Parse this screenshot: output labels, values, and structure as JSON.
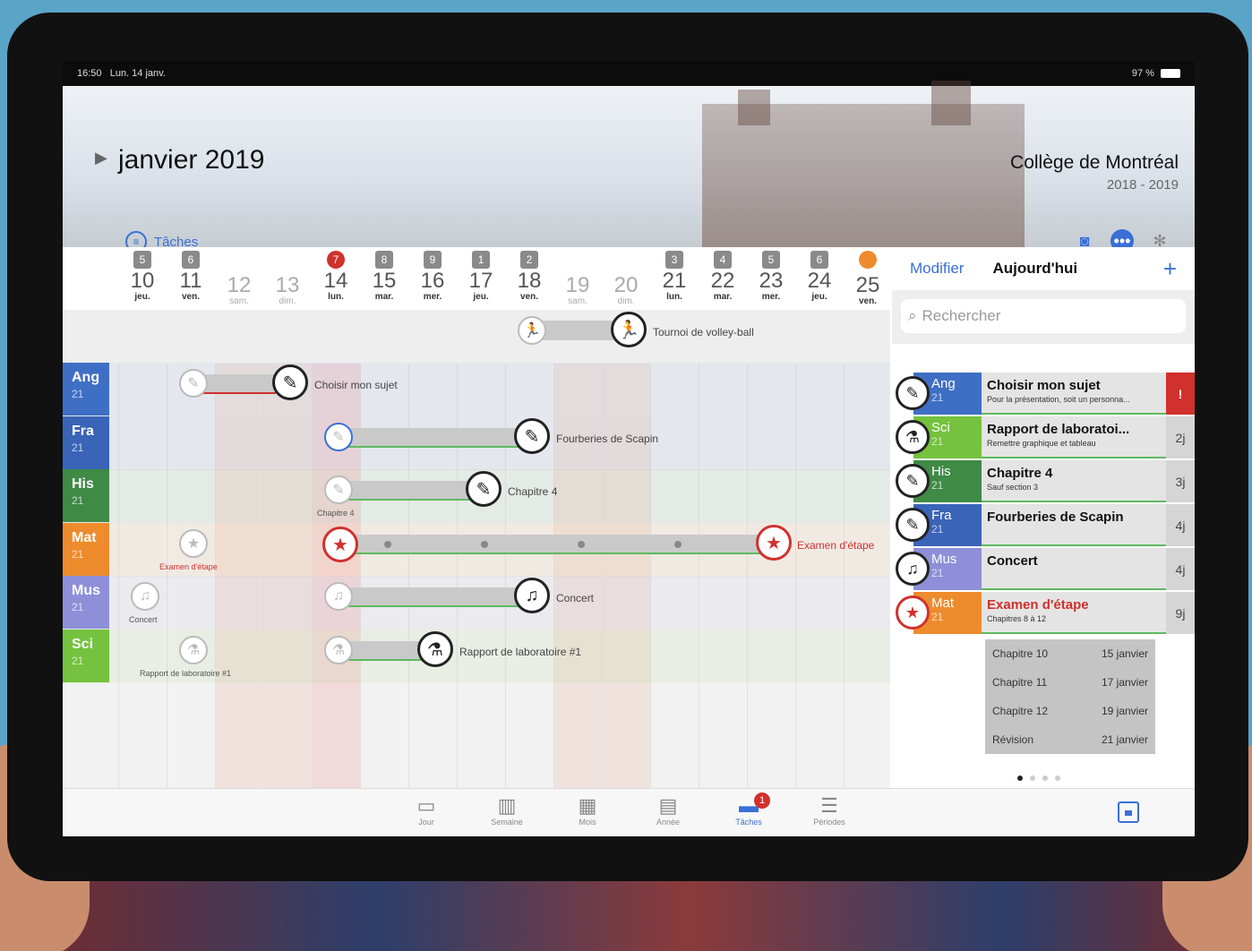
{
  "status": {
    "time": "16:50",
    "date": "Lun. 14 janv.",
    "battery": "97 %"
  },
  "header": {
    "month": "janvier 2019",
    "tasks_label": "Tâches",
    "school_name": "Collège de Montréal",
    "school_years": "2018 - 2019"
  },
  "days": [
    {
      "badge": "5",
      "num": "10",
      "name": "jeu."
    },
    {
      "badge": "6",
      "num": "11",
      "name": "ven."
    },
    {
      "badge": "",
      "num": "12",
      "name": "sam."
    },
    {
      "badge": "",
      "num": "13",
      "name": "dim."
    },
    {
      "badge": "7",
      "num": "14",
      "name": "lun."
    },
    {
      "badge": "8",
      "num": "15",
      "name": "mar."
    },
    {
      "badge": "9",
      "num": "16",
      "name": "mer."
    },
    {
      "badge": "1",
      "num": "17",
      "name": "jeu."
    },
    {
      "badge": "2",
      "num": "18",
      "name": "ven."
    },
    {
      "badge": "",
      "num": "19",
      "name": "sam."
    },
    {
      "badge": "",
      "num": "20",
      "name": "dim."
    },
    {
      "badge": "3",
      "num": "21",
      "name": "lun."
    },
    {
      "badge": "4",
      "num": "22",
      "name": "mar."
    },
    {
      "badge": "5",
      "num": "23",
      "name": "mer."
    },
    {
      "badge": "6",
      "num": "24",
      "name": "jeu."
    },
    {
      "badge": "",
      "num": "25",
      "name": "ven."
    }
  ],
  "subjects": [
    {
      "code": "Ang",
      "num": "21",
      "color": "#3f6fc4"
    },
    {
      "code": "Fra",
      "num": "21",
      "color": "#3a64b8"
    },
    {
      "code": "His",
      "num": "21",
      "color": "#3f8a45"
    },
    {
      "code": "Mat",
      "num": "21",
      "color": "#ee8b2d"
    },
    {
      "code": "Mus",
      "num": "21",
      "color": "#8e8fd8"
    },
    {
      "code": "Sci",
      "num": "21",
      "color": "#74c23e"
    }
  ],
  "events": {
    "volley": "Tournoi de volley-ball",
    "ang": "Choisir mon sujet",
    "fra": "Fourberies de Scapin",
    "his": "Chapitre 4",
    "his_small": "Chapitre 4",
    "mat": "Examen d'étape",
    "mat_small": "Examen d'étape",
    "mus": "Concert",
    "mus_small": "Concert",
    "sci": "Rapport de laboratoire #1",
    "sci_small": "Rapport de laboratoire #1"
  },
  "panel": {
    "edit": "Modifier",
    "today": "Aujourd'hui",
    "plus": "+",
    "search_placeholder": "Rechercher",
    "tasks": [
      {
        "code": "Ang",
        "num": "21",
        "title": "Choisir mon sujet",
        "sub": "Pour la présentation, soit un personna...",
        "due": "!",
        "color": "#3f6fc4"
      },
      {
        "code": "Sci",
        "num": "21",
        "title": "Rapport de laboratoi...",
        "sub": "Remettre graphique et tableau",
        "due": "2j",
        "color": "#74c23e"
      },
      {
        "code": "His",
        "num": "21",
        "title": "Chapitre 4",
        "sub": "Sauf section 3",
        "due": "3j",
        "color": "#3f8a45"
      },
      {
        "code": "Fra",
        "num": "21",
        "title": "Fourberies de Scapin",
        "sub": "",
        "due": "4j",
        "color": "#3a64b8"
      },
      {
        "code": "Mus",
        "num": "21",
        "title": "Concert",
        "sub": "",
        "due": "4j",
        "color": "#8e8fd8"
      },
      {
        "code": "Mat",
        "num": "21",
        "title": "Examen d'étape",
        "sub": "Chapitres 8 à 12",
        "due": "9j",
        "color": "#ee8b2d"
      }
    ],
    "steps": [
      {
        "label": "Chapitre 10",
        "date": "15 janvier"
      },
      {
        "label": "Chapitre 11",
        "date": "17 janvier"
      },
      {
        "label": "Chapitre 12",
        "date": "19 janvier"
      },
      {
        "label": "Révision",
        "date": "21 janvier"
      }
    ]
  },
  "tabbar": {
    "jour": "Jour",
    "semaine": "Semaine",
    "mois": "Mois",
    "annee": "Année",
    "taches": "Tâches",
    "taches_badge": "1",
    "periodes": "Périodes"
  }
}
